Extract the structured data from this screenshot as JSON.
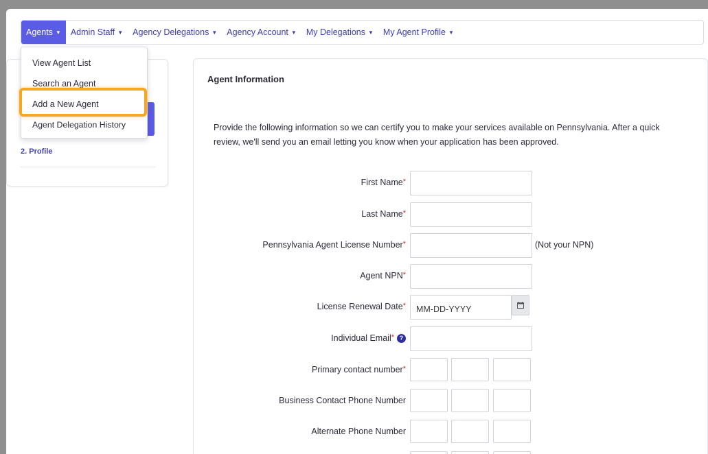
{
  "nav": {
    "items": [
      {
        "label": "Agents"
      },
      {
        "label": "Admin Staff"
      },
      {
        "label": "Agency Delegations"
      },
      {
        "label": "Agency Account"
      },
      {
        "label": "My Delegations"
      },
      {
        "label": "My Agent Profile"
      }
    ]
  },
  "dropdown": {
    "items": [
      {
        "label": "View Agent List"
      },
      {
        "label": "Search an Agent"
      },
      {
        "label": "Add a New Agent"
      },
      {
        "label": "Agent Delegation History"
      }
    ]
  },
  "sidebar": {
    "step_profile": "2. Profile"
  },
  "main": {
    "title": "Agent Information",
    "intro": "Provide the following information so we can certify you to make your services available on Pennsylvania. After a quick review, we'll send you an email letting you know when your application has been approved.",
    "fields": {
      "first_name": "First Name",
      "last_name": "Last Name",
      "license_number": "Pennsylvania Agent License Number",
      "license_note": "(Not your NPN)",
      "agent_npn": "Agent NPN",
      "renewal_date": "License Renewal Date",
      "renewal_placeholder": "MM-DD-YYYY",
      "email": "Individual Email",
      "primary_phone": "Primary contact number",
      "business_phone": "Business Contact Phone Number",
      "alternate_phone": "Alternate Phone Number"
    },
    "required_mark": "*",
    "help_glyph": "?"
  },
  "colors": {
    "accent": "#5a5ce6",
    "nav_text": "#3d3fb0",
    "required": "#c62828",
    "highlight": "#f5a623"
  }
}
